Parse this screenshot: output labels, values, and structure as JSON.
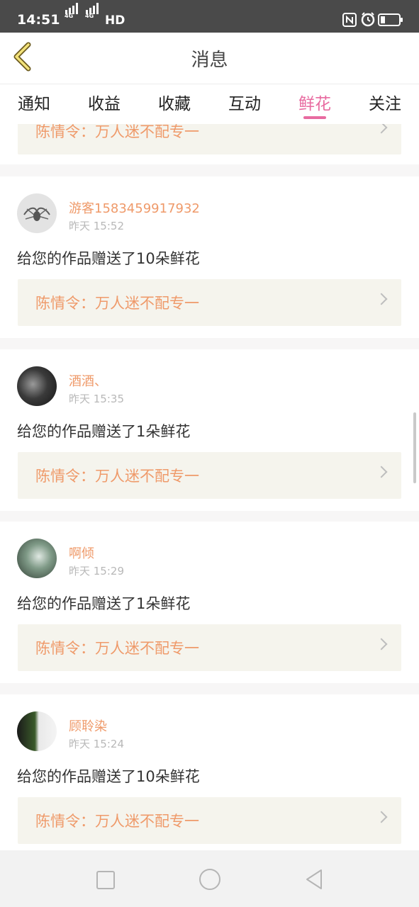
{
  "status_bar": {
    "time": "14:51",
    "signal_1": "4G",
    "signal_2": "4G",
    "hd": "HD",
    "icons": [
      "nfc-icon",
      "alarm-icon",
      "battery-icon"
    ]
  },
  "header": {
    "title": "消息",
    "back_icon": "back-arrow-icon"
  },
  "tabs": [
    {
      "label": "通知",
      "active": false
    },
    {
      "label": "收益",
      "active": false
    },
    {
      "label": "收藏",
      "active": false
    },
    {
      "label": "互动",
      "active": false
    },
    {
      "label": "鲜花",
      "active": true
    },
    {
      "label": "关注",
      "active": false
    }
  ],
  "colors": {
    "accent": "#e86ba0",
    "username": "#ef9a6a",
    "link_bg": "#f5f4ed"
  },
  "partial_item": {
    "work_title": "陈情令：万人迷不配专一"
  },
  "items": [
    {
      "user": "游客1583459917932",
      "time": "昨天 15:52",
      "message": "给您的作品赠送了10朵鲜花",
      "work_title": "陈情令：万人迷不配专一"
    },
    {
      "user": "酒酒、",
      "time": "昨天 15:35",
      "message": "给您的作品赠送了1朵鲜花",
      "work_title": "陈情令：万人迷不配专一"
    },
    {
      "user": "啊倾",
      "time": "昨天 15:29",
      "message": "给您的作品赠送了1朵鲜花",
      "work_title": "陈情令：万人迷不配专一"
    },
    {
      "user": "顾聆染",
      "time": "昨天 15:24",
      "message": "给您的作品赠送了10朵鲜花",
      "work_title": "陈情令：万人迷不配专一"
    }
  ],
  "nav": {
    "recent_icon": "square-recent-apps-icon",
    "home_icon": "circle-home-icon",
    "back_icon": "triangle-back-icon"
  }
}
